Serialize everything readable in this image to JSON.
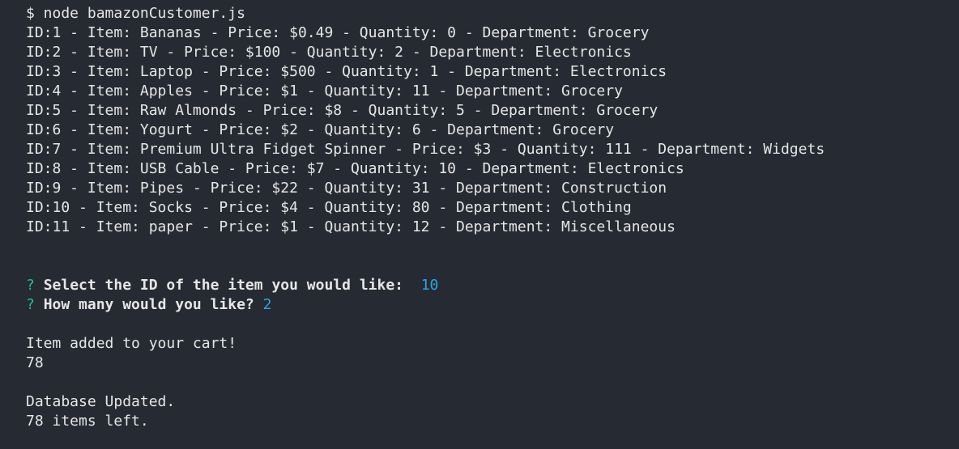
{
  "terminal": {
    "top_clipped_line": "",
    "command": "$ node bamazonCustomer.js",
    "products": [
      "ID:1 - Item: Bananas - Price: $0.49 - Quantity: 0 - Department: Grocery",
      "ID:2 - Item: TV - Price: $100 - Quantity: 2 - Department: Electronics",
      "ID:3 - Item: Laptop - Price: $500 - Quantity: 1 - Department: Electronics",
      "ID:4 - Item: Apples - Price: $1 - Quantity: 11 - Department: Grocery",
      "ID:5 - Item: Raw Almonds - Price: $8 - Quantity: 5 - Department: Grocery",
      "ID:6 - Item: Yogurt - Price: $2 - Quantity: 6 - Department: Grocery",
      "ID:7 - Item: Premium Ultra Fidget Spinner - Price: $3 - Quantity: 111 - Department: Widgets",
      "ID:8 - Item: USB Cable - Price: $7 - Quantity: 10 - Department: Electronics",
      "ID:9 - Item: Pipes - Price: $22 - Quantity: 31 - Department: Construction",
      "ID:10 - Item: Socks - Price: $4 - Quantity: 80 - Department: Clothing",
      "ID:11 - Item: paper - Price: $1 - Quantity: 12 - Department: Miscellaneous"
    ],
    "prompts": [
      {
        "mark": "?",
        "question": "Select the ID of the item you would like:",
        "answer": "10",
        "gap": "  "
      },
      {
        "mark": "?",
        "question": "How many would you like?",
        "answer": "2",
        "gap": " "
      }
    ],
    "cart_message": "Item added to your cart!",
    "cart_quantity": "78",
    "db_message": "Database Updated.",
    "items_left": "78 items left.",
    "colors": {
      "background": "#262a33",
      "text": "#e6e6e6",
      "prompt_mark": "#23c38d",
      "answer": "#2aa6e0"
    }
  }
}
